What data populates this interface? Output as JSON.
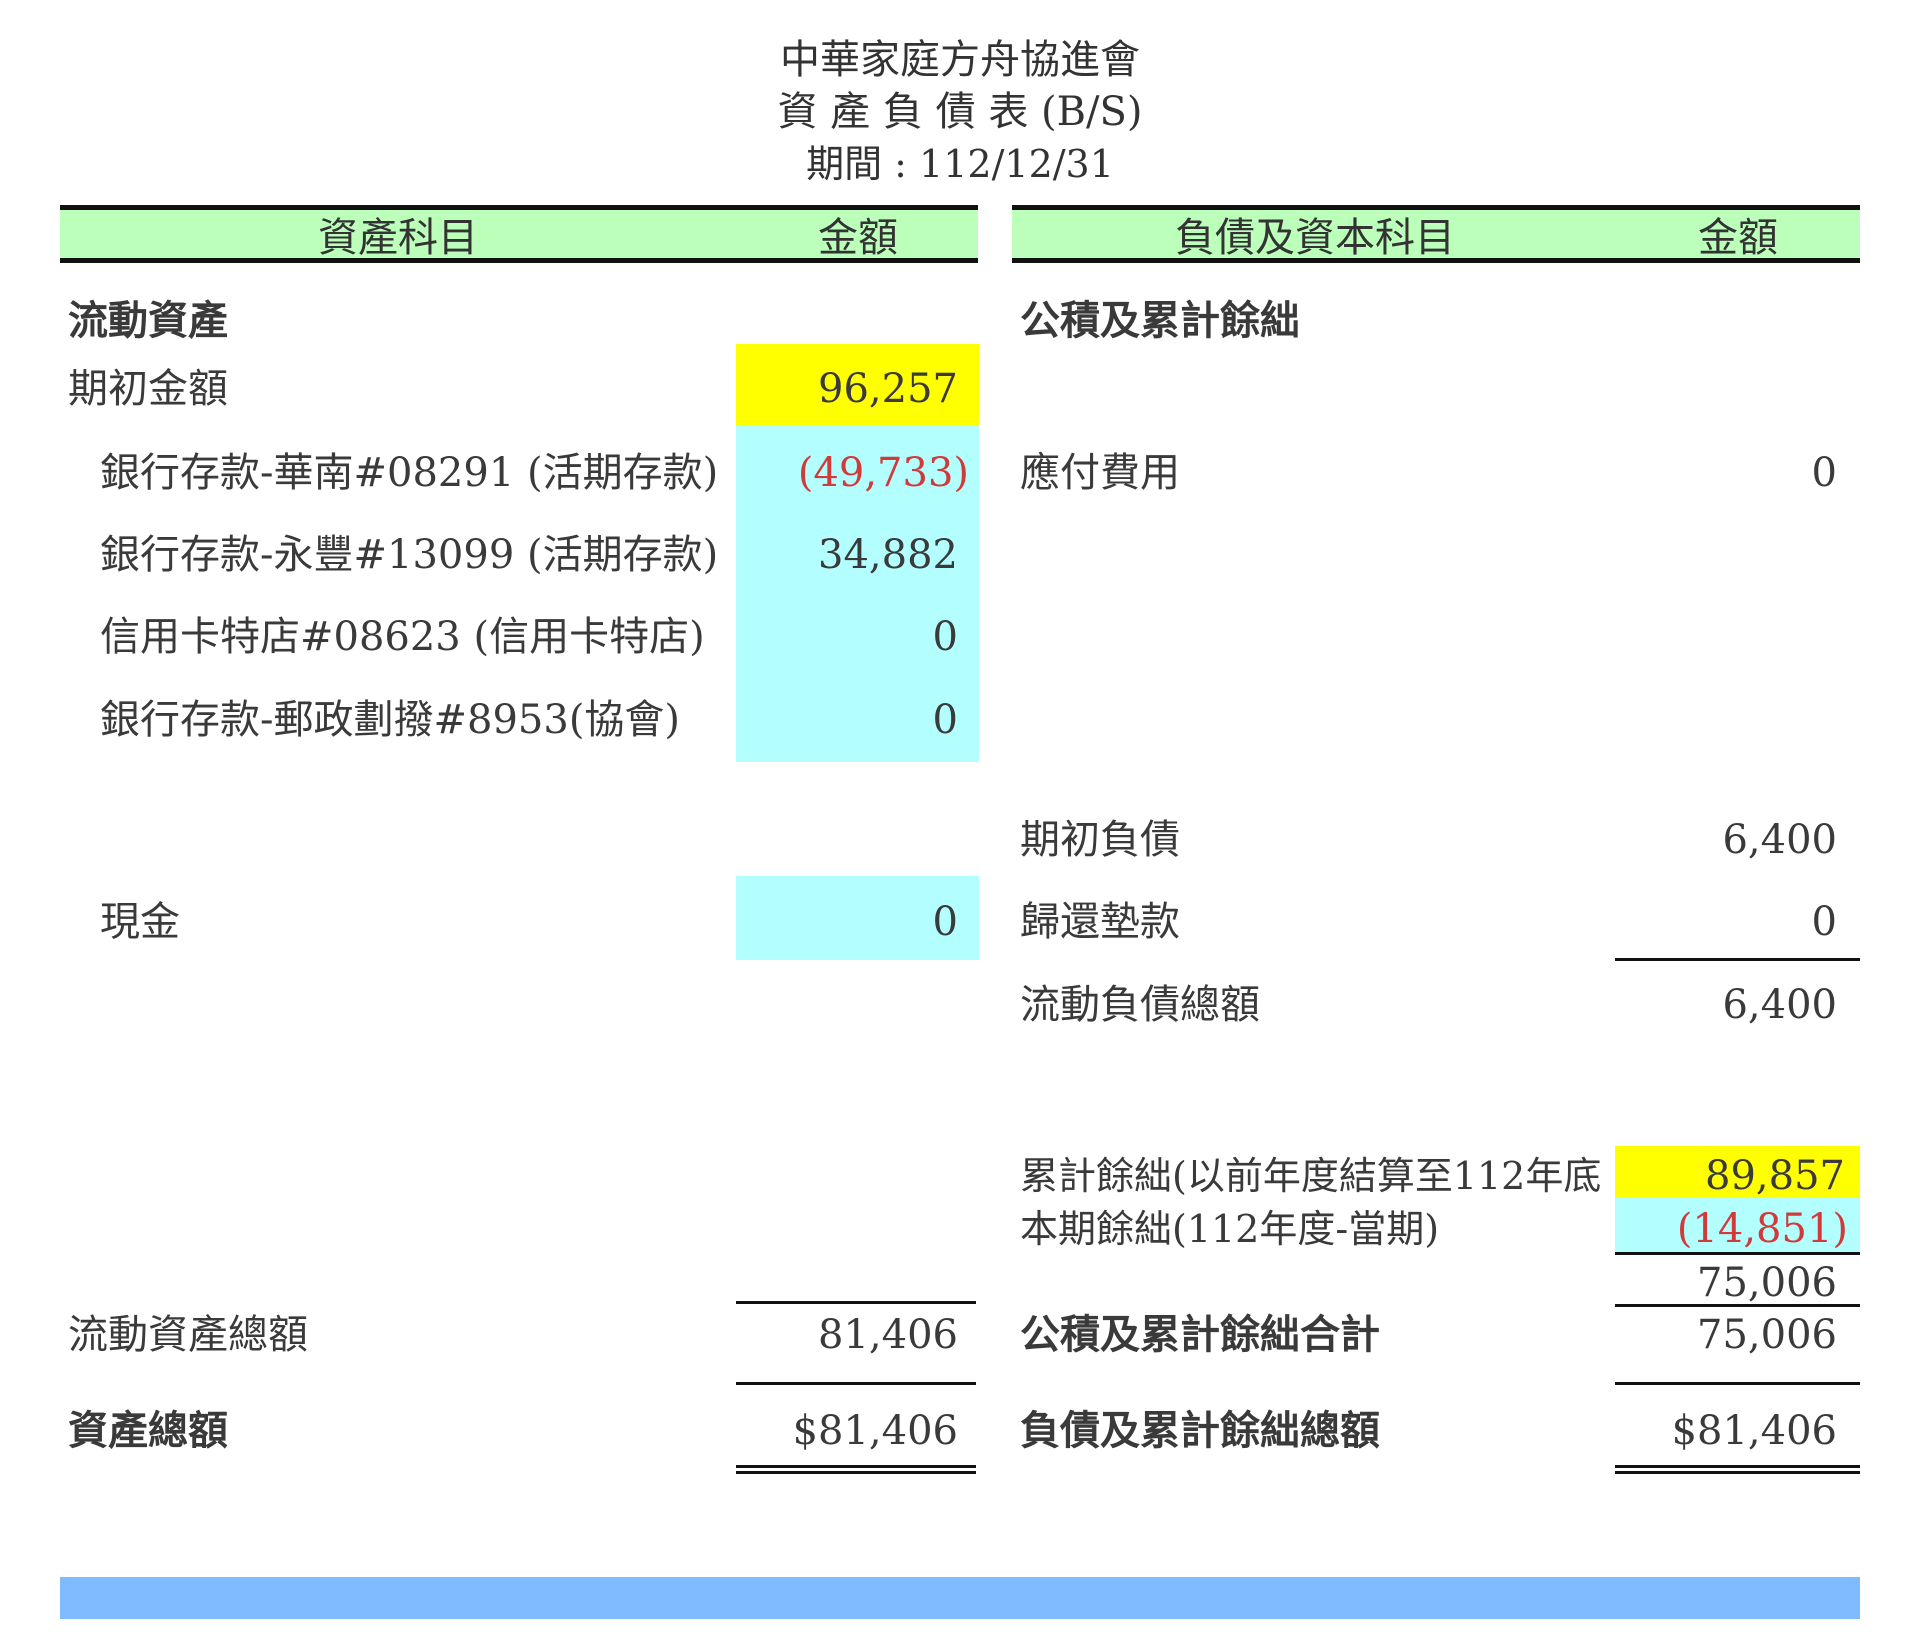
{
  "header": {
    "org_name": "中華家庭方舟協進會",
    "report_title": "資 產 負 債 表 (B/S)",
    "period": "期間 : 112/12/31"
  },
  "columns": {
    "assets_title": "資產科目",
    "assets_amount": "金額",
    "liab_title": "負債及資本科目",
    "liab_amount": "金額"
  },
  "assets": {
    "section": "流動資產",
    "opening_label": "期初金額",
    "opening_value": "96,257",
    "items": [
      {
        "label": "銀行存款-華南#08291 (活期存款)",
        "value": "(49,733)"
      },
      {
        "label": "銀行存款-永豐#13099 (活期存款)",
        "value": "34,882"
      },
      {
        "label": "信用卡特店#08623 (信用卡特店)",
        "value": "0"
      },
      {
        "label": "銀行存款-郵政劃撥#8953(協會)",
        "value": "0"
      }
    ],
    "cash_label": "現金",
    "cash_value": "0",
    "current_total_label": "流動資產總額",
    "current_total_value": "81,406",
    "total_label": "資產總額",
    "total_value": "$81,406"
  },
  "liabilities": {
    "section": "公積及累計餘絀",
    "accrued_label": "應付費用",
    "accrued_value": "0",
    "opening_label": "期初負債",
    "opening_value": "6,400",
    "repay_label": "歸還墊款",
    "repay_value": "0",
    "current_total_label": "流動負債總額",
    "current_total_value": "6,400",
    "cumulative_label": "累計餘絀(以前年度結算至112年底",
    "cumulative_value": "89,857",
    "period_label": "本期餘絀(112年度-當期)",
    "period_value": "(14,851)",
    "subtotal_value": "75,006",
    "reserve_total_label": "公積及累計餘絀合計",
    "reserve_total_value": "75,006",
    "grand_total_label": "負債及累計餘絀總額",
    "grand_total_value": "$81,406"
  }
}
